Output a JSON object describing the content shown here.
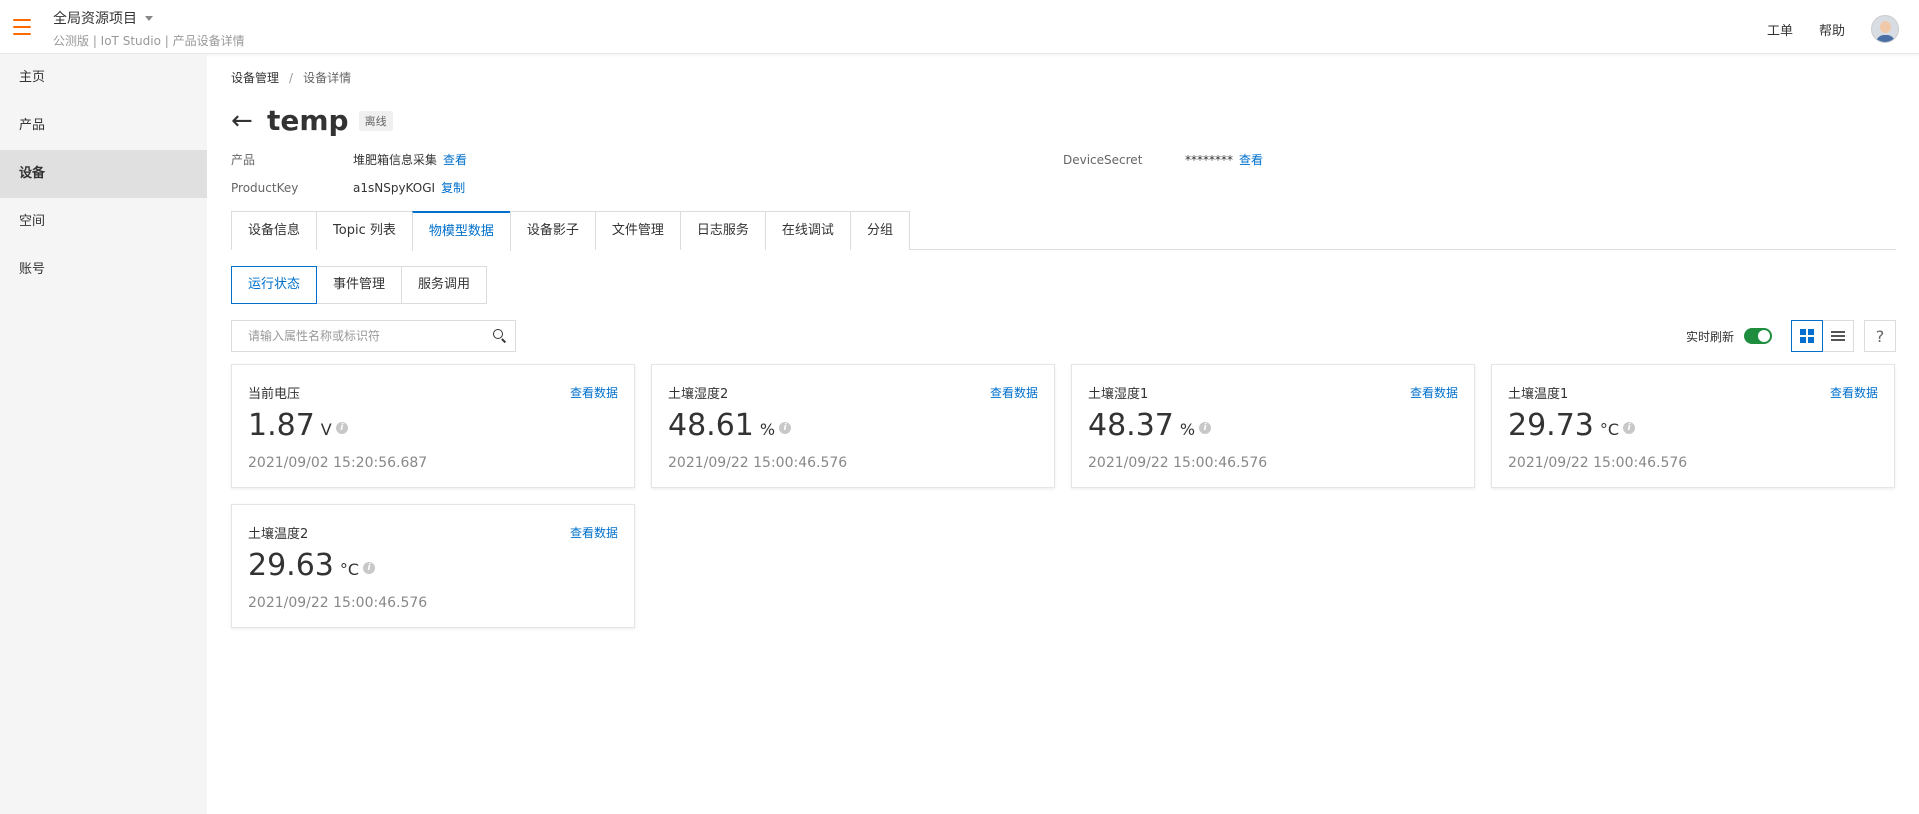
{
  "header": {
    "project_title": "全局资源项目",
    "project_sub": "公测版 | IoT Studio | 产品设备详情",
    "work_order": "工单",
    "help": "帮助"
  },
  "sidebar": {
    "items": [
      {
        "label": "主页"
      },
      {
        "label": "产品"
      },
      {
        "label": "设备",
        "active": true
      },
      {
        "label": "空间"
      },
      {
        "label": "账号"
      }
    ]
  },
  "breadcrumb": {
    "parent": "设备管理",
    "separator": "/",
    "current": "设备详情"
  },
  "device": {
    "name": "temp",
    "status": "离线",
    "product_label": "产品",
    "product_value": "堆肥箱信息采集",
    "product_link": "查看",
    "productkey_label": "ProductKey",
    "productkey_value": "a1sNSpyKOGI",
    "productkey_link": "复制",
    "secret_label": "DeviceSecret",
    "secret_value": "********",
    "secret_link": "查看"
  },
  "tabs": [
    "设备信息",
    "Topic 列表",
    "物模型数据",
    "设备影子",
    "文件管理",
    "日志服务",
    "在线调试",
    "分组"
  ],
  "active_tab": 2,
  "subtabs": [
    "运行状态",
    "事件管理",
    "服务调用"
  ],
  "active_subtab": 0,
  "toolbar": {
    "search_placeholder": "请输入属性名称或标识符",
    "realtime_label": "实时刷新",
    "realtime_on": true,
    "help_symbol": "?"
  },
  "cards": [
    {
      "name": "当前电压",
      "value": "1.87",
      "unit": "V",
      "time": "2021/09/02 15:20:56.687",
      "link": "查看数据"
    },
    {
      "name": "土壤湿度2",
      "value": "48.61",
      "unit": "%",
      "time": "2021/09/22 15:00:46.576",
      "link": "查看数据"
    },
    {
      "name": "土壤湿度1",
      "value": "48.37",
      "unit": "%",
      "time": "2021/09/22 15:00:46.576",
      "link": "查看数据"
    },
    {
      "name": "土壤温度1",
      "value": "29.73",
      "unit": "°C",
      "time": "2021/09/22 15:00:46.576",
      "link": "查看数据"
    },
    {
      "name": "土壤温度2",
      "value": "29.63",
      "unit": "°C",
      "time": "2021/09/22 15:00:46.576",
      "link": "查看数据"
    }
  ],
  "colors": {
    "accent": "#0070cc",
    "brand_menu": "#ff6a00",
    "toggle_on": "#1e8e3e"
  }
}
